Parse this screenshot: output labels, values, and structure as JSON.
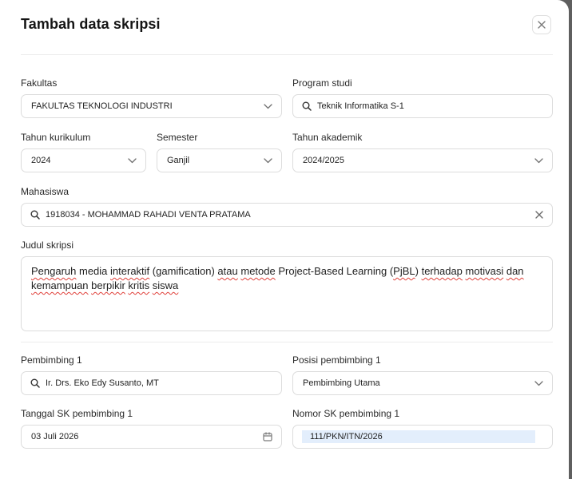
{
  "dialog": {
    "title": "Tambah data skripsi"
  },
  "fields": {
    "fakultas": {
      "label": "Fakultas",
      "value": "FAKULTAS TEKNOLOGI INDUSTRI"
    },
    "program_studi": {
      "label": "Program studi",
      "value": "Teknik Informatika S-1"
    },
    "tahun_kurikulum": {
      "label": "Tahun kurikulum",
      "value": "2024"
    },
    "semester": {
      "label": "Semester",
      "value": "Ganjil"
    },
    "tahun_akademik": {
      "label": "Tahun akademik",
      "value": "2024/2025"
    },
    "mahasiswa": {
      "label": "Mahasiswa",
      "value": "1918034 - MOHAMMAD RAHADI VENTA PRATAMA"
    },
    "judul_skripsi": {
      "label": "Judul skripsi",
      "segments": [
        {
          "text": "Pengaruh",
          "spell": true
        },
        {
          "text": " media ",
          "spell": false
        },
        {
          "text": "interaktif",
          "spell": true
        },
        {
          "text": " (gamification) ",
          "spell": false
        },
        {
          "text": "atau",
          "spell": true
        },
        {
          "text": " ",
          "spell": false
        },
        {
          "text": "metode",
          "spell": true
        },
        {
          "text": " Project-Based Learning (",
          "spell": false
        },
        {
          "text": "PjBL",
          "spell": true
        },
        {
          "text": ") ",
          "spell": false
        },
        {
          "text": "terhadap",
          "spell": true
        },
        {
          "text": " ",
          "spell": false
        },
        {
          "text": "motivasi",
          "spell": true
        },
        {
          "text": " ",
          "spell": false
        },
        {
          "text": "dan",
          "spell": true
        },
        {
          "text": " ",
          "spell": false
        },
        {
          "text": "kemampuan",
          "spell": true
        },
        {
          "text": " ",
          "spell": false
        },
        {
          "text": "berpikir",
          "spell": true
        },
        {
          "text": " ",
          "spell": false
        },
        {
          "text": "kritis",
          "spell": true
        },
        {
          "text": " ",
          "spell": false
        },
        {
          "text": "siswa",
          "spell": true
        }
      ]
    },
    "pembimbing_1": {
      "label": "Pembimbing 1",
      "value": "Ir. Drs. Eko Edy Susanto, MT"
    },
    "posisi_pembimbing_1": {
      "label": "Posisi pembimbing 1",
      "value": "Pembimbing Utama"
    },
    "tanggal_sk_pembimbing_1": {
      "label": "Tanggal SK pembimbing 1",
      "value": "03 Juli 2026"
    },
    "nomor_sk_pembimbing_1": {
      "label": "Nomor SK pembimbing 1",
      "value": "111/PKN/ITN/2026"
    }
  },
  "icons": {
    "close": "close-icon",
    "dropdown": "chevron-down-icon",
    "search": "search-icon",
    "clear": "clear-icon",
    "calendar": "calendar-icon"
  },
  "colors": {
    "selection_highlight": "#e3eefc",
    "spellcheck_underline": "#e0403a",
    "border": "#dcdcdc"
  }
}
